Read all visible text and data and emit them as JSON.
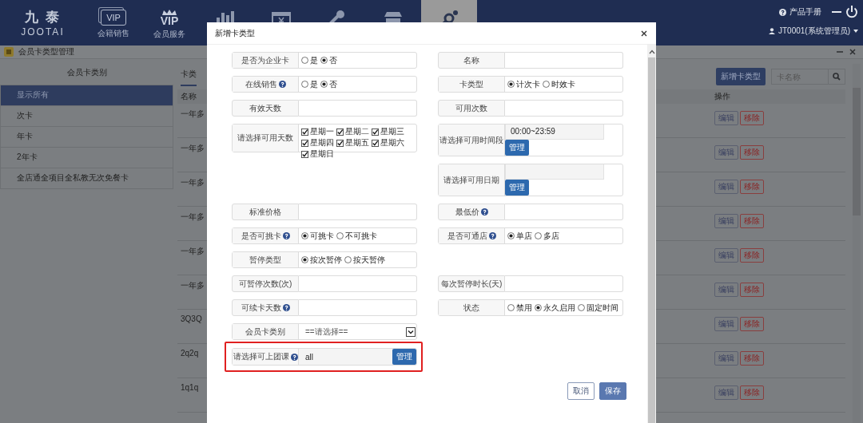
{
  "header": {
    "logo_cn": "九 泰",
    "logo_en": "JOOTAI",
    "manual": "产品手册",
    "user": "JT0001(系统管理员)",
    "nav": [
      {
        "kind": "vip-card",
        "icon_text": "VIP",
        "label": "会籍销售",
        "selected": false
      },
      {
        "kind": "vip-crown",
        "icon_text": "VIP",
        "label": "会员服务",
        "selected": false
      },
      {
        "kind": "chart",
        "selected": false
      },
      {
        "kind": "ticket",
        "selected": false
      },
      {
        "kind": "tools",
        "selected": false
      },
      {
        "kind": "store",
        "selected": false
      },
      {
        "kind": "settings",
        "selected": true
      }
    ]
  },
  "page": {
    "title": "会员卡类型管理"
  },
  "sidebar": {
    "title": "会员卡类别",
    "items": [
      {
        "label": "显示所有",
        "selected": true
      },
      {
        "label": "次卡",
        "selected": false
      },
      {
        "label": "年卡",
        "selected": false
      },
      {
        "label": "2年卡",
        "selected": false
      },
      {
        "label": "全店通全项目全私教无次免餐卡",
        "selected": false
      }
    ]
  },
  "main": {
    "tab": "卡类",
    "add_button": "新增卡类型",
    "search": {
      "placeholder": "卡名称"
    },
    "table": {
      "columns": [
        "名称",
        "操作"
      ],
      "rows": [
        {
          "name": "一年多",
          "actions": [
            "编辑",
            "移除"
          ]
        },
        {
          "name": "一年多",
          "actions": [
            "编辑",
            "移除"
          ]
        },
        {
          "name": "一年多",
          "actions": [
            "编辑",
            "移除"
          ]
        },
        {
          "name": "一年多",
          "actions": [
            "编辑",
            "移除"
          ]
        },
        {
          "name": "一年多",
          "actions": [
            "编辑",
            "移除"
          ]
        },
        {
          "name": "一年多",
          "actions": [
            "编辑",
            "移除"
          ]
        },
        {
          "name": "3Q3Q",
          "actions": [
            "编辑",
            "移除"
          ]
        },
        {
          "name": "2q2q",
          "actions": [
            "编辑",
            "移除"
          ]
        },
        {
          "name": "1q1q",
          "actions": [
            "编辑",
            "移除"
          ]
        }
      ]
    }
  },
  "dialog": {
    "title": "新增卡类型",
    "rows": [
      {
        "left": {
          "label": "是否为企业卡",
          "kind": "radio",
          "options": [
            {
              "label": "是",
              "selected": false
            },
            {
              "label": "否",
              "selected": true
            }
          ]
        },
        "right": {
          "label": "名称",
          "kind": "text"
        }
      },
      {
        "left": {
          "label": "在线销售",
          "help": true,
          "kind": "radio",
          "options": [
            {
              "label": "是",
              "selected": false
            },
            {
              "label": "否",
              "selected": true
            }
          ]
        },
        "right": {
          "label": "卡类型",
          "kind": "radio",
          "options": [
            {
              "label": "计次卡",
              "selected": true
            },
            {
              "label": "时效卡",
              "selected": false
            }
          ]
        }
      },
      {
        "left": {
          "label": "有效天数",
          "kind": "text"
        },
        "right": {
          "label": "可用次数",
          "kind": "text"
        }
      },
      {
        "left": {
          "label": "请选择可用天数",
          "kind": "checkbox",
          "options": [
            {
              "label": "星期一",
              "checked": true
            },
            {
              "label": "星期二",
              "checked": true
            },
            {
              "label": "星期三",
              "checked": true
            },
            {
              "label": "星期四",
              "checked": true
            },
            {
              "label": "星期五",
              "checked": true
            },
            {
              "label": "星期六",
              "checked": true
            },
            {
              "label": "星期日",
              "checked": true
            }
          ]
        },
        "right": {
          "label": "请选择可用时间段",
          "kind": "picker",
          "value": "00:00~23:59",
          "button": "管理"
        }
      },
      {
        "right": {
          "label": "请选择可用日期",
          "kind": "picker",
          "button": "管理"
        }
      },
      {
        "left": {
          "label": "标准价格",
          "kind": "text"
        },
        "right": {
          "label": "最低价",
          "help": true,
          "kind": "text"
        }
      },
      {
        "left": {
          "label": "是否可挑卡",
          "help": true,
          "kind": "radio",
          "options": [
            {
              "label": "可挑卡",
              "selected": true
            },
            {
              "label": "不可挑卡",
              "selected": false
            }
          ]
        },
        "right": {
          "label": "是否可通店",
          "help": true,
          "kind": "radio",
          "options": [
            {
              "label": "单店",
              "selected": true
            },
            {
              "label": "多店",
              "selected": false
            }
          ]
        }
      },
      {
        "left": {
          "label": "暂停类型",
          "kind": "radio",
          "options": [
            {
              "label": "按次暂停",
              "selected": true
            },
            {
              "label": "按天暂停",
              "selected": false
            }
          ]
        }
      },
      {
        "left": {
          "label": "可暂停次数(次)",
          "kind": "text"
        },
        "right": {
          "label": "每次暂停时长(天)",
          "kind": "text"
        }
      },
      {
        "left": {
          "label": "可续卡天数",
          "help": true,
          "kind": "text"
        },
        "right": {
          "label": "状态",
          "kind": "radio",
          "options": [
            {
              "label": "禁用",
              "selected": false
            },
            {
              "label": "永久启用",
              "selected": true
            },
            {
              "label": "固定时间",
              "selected": false
            }
          ]
        }
      },
      {
        "left": {
          "label": "会员卡类别",
          "kind": "select",
          "value": "==请选择=="
        }
      },
      {
        "left": {
          "label": "请选择可上团课",
          "help": true,
          "kind": "inline-picker",
          "value": "all",
          "button": "管理",
          "highlighted": true
        }
      }
    ],
    "buttons": [
      {
        "label": "取消",
        "kind": "secondary"
      },
      {
        "label": "保存",
        "kind": "primary"
      }
    ]
  }
}
